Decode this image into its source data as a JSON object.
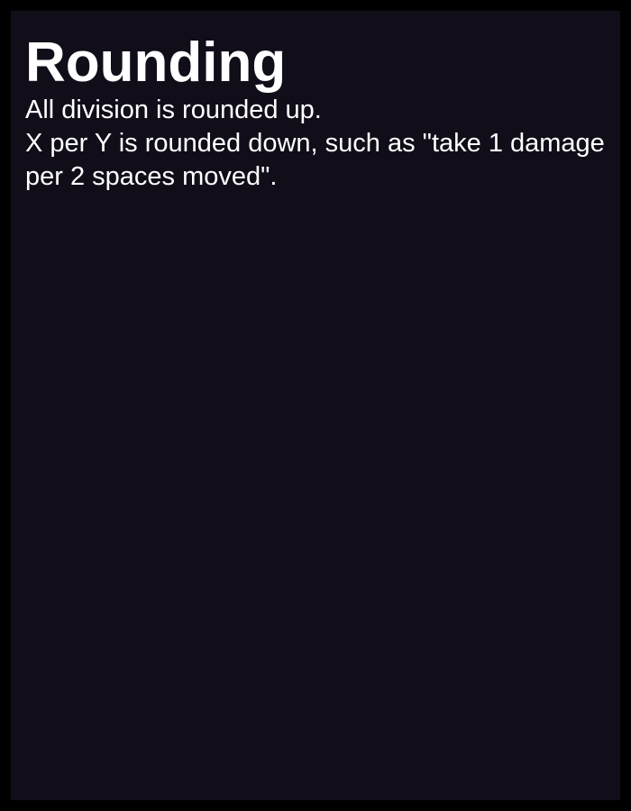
{
  "card": {
    "title": "Rounding",
    "paragraphs": [
      "All division is rounded up.",
      "X per Y is rounded down, such as \"take 1 damage per 2 spaces moved\"."
    ]
  },
  "colors": {
    "frame": "#000000",
    "card_background": "#110d19",
    "text": "#ffffff"
  }
}
